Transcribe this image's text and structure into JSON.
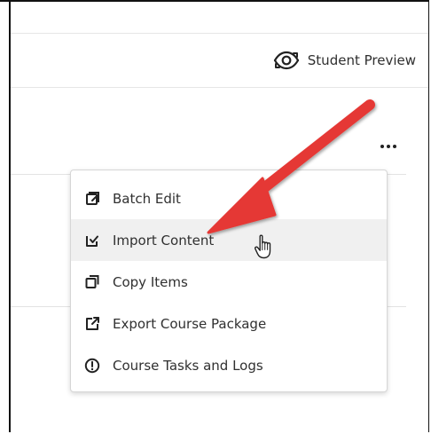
{
  "header": {
    "student_preview_label": "Student Preview"
  },
  "toolbar": {
    "more_options_icon": "more-horizontal-icon"
  },
  "menu": {
    "items": [
      {
        "label": "Batch Edit",
        "icon": "batch-edit-icon"
      },
      {
        "label": "Import Content",
        "icon": "import-content-icon"
      },
      {
        "label": "Copy Items",
        "icon": "copy-items-icon"
      },
      {
        "label": "Export Course Package",
        "icon": "export-course-package-icon"
      },
      {
        "label": "Course Tasks and Logs",
        "icon": "course-tasks-logs-icon"
      }
    ]
  },
  "annotation": {
    "arrow_color": "#e53935",
    "highlighted_item": "Import Content"
  }
}
